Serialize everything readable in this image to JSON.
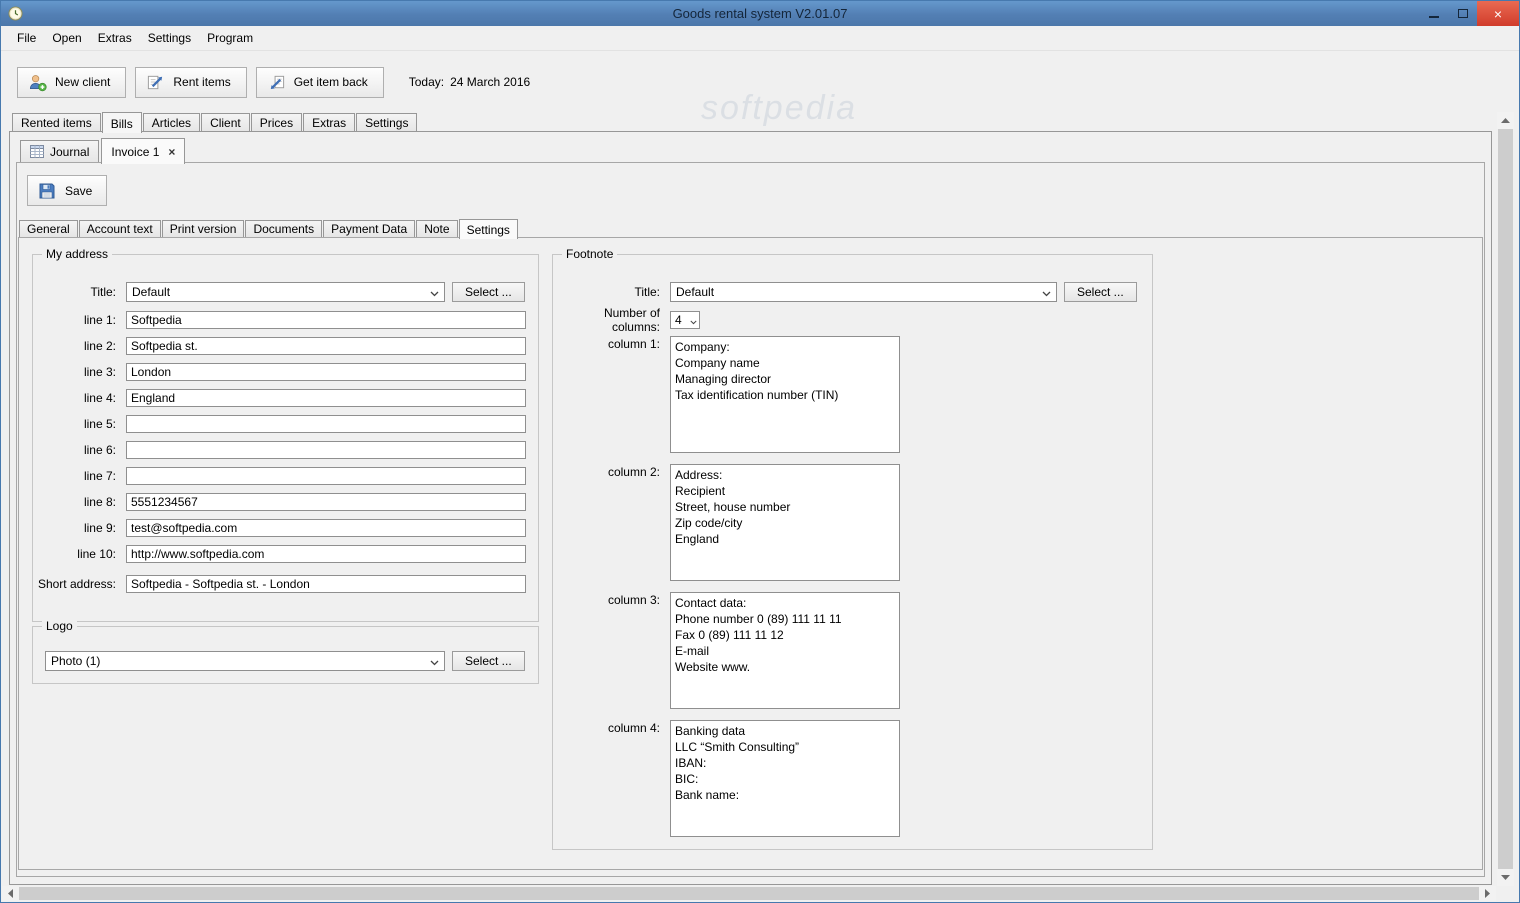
{
  "window": {
    "title": "Goods rental system V2.01.07"
  },
  "watermark": "softpedia",
  "menu": [
    "File",
    "Open",
    "Extras",
    "Settings",
    "Program"
  ],
  "toolbar": {
    "new_client": "New client",
    "rent_items": "Rent items",
    "get_item_back": "Get item back",
    "today_label": "Today:",
    "today_date": "24 March 2016"
  },
  "main_tabs": [
    "Rented items",
    "Bills",
    "Articles",
    "Client",
    "Prices",
    "Extras",
    "Settings"
  ],
  "document_tabs": {
    "journal": "Journal",
    "invoice": "Invoice 1",
    "close_glyph": "×"
  },
  "save_button": "Save",
  "invoice_tabs": [
    "General",
    "Account text",
    "Print version",
    "Documents",
    "Payment Data",
    "Note",
    "Settings"
  ],
  "my_address": {
    "group_label": "My address",
    "title_label": "Title:",
    "title_value": "Default",
    "select_button": "Select ...",
    "lines": [
      {
        "label": "line 1:",
        "value": "Softpedia"
      },
      {
        "label": "line 2:",
        "value": "Softpedia st."
      },
      {
        "label": "line 3:",
        "value": "London"
      },
      {
        "label": "line 4:",
        "value": "England"
      },
      {
        "label": "line 5:",
        "value": ""
      },
      {
        "label": "line 6:",
        "value": ""
      },
      {
        "label": "line 7:",
        "value": ""
      },
      {
        "label": "line 8:",
        "value": "5551234567"
      },
      {
        "label": "line 9:",
        "value": "test@softpedia.com"
      },
      {
        "label": "line 10:",
        "value": "http://www.softpedia.com"
      }
    ],
    "short_address_label": "Short address:",
    "short_address_value": "Softpedia - Softpedia st. - London"
  },
  "logo": {
    "group_label": "Logo",
    "value": "Photo (1)",
    "select_button": "Select ..."
  },
  "footnote": {
    "group_label": "Footnote",
    "title_label": "Title:",
    "title_value": "Default",
    "select_button": "Select ...",
    "columns_label": "Number of columns:",
    "columns_value": "4",
    "columns": [
      {
        "label": "column 1:",
        "value": "Company:\nCompany name\nManaging director\nTax identification number (TIN)"
      },
      {
        "label": "column 2:",
        "value": "Address:\nRecipient\nStreet, house number\nZip code/city\nEngland"
      },
      {
        "label": "column 3:",
        "value": "Contact data:\nPhone number 0 (89) 111 11 11\nFax 0 (89) 111 11 12\nE-mail\nWebsite www."
      },
      {
        "label": "column 4:",
        "value": "Banking data\nLLC “Smith Consulting”\nIBAN:\nBIC:\nBank name:"
      }
    ]
  },
  "colors": {
    "titlebar": "#537fb4",
    "close_button": "#d03c2b",
    "accent_blue": "#3f6fb5",
    "background": "#f0f0f0"
  }
}
